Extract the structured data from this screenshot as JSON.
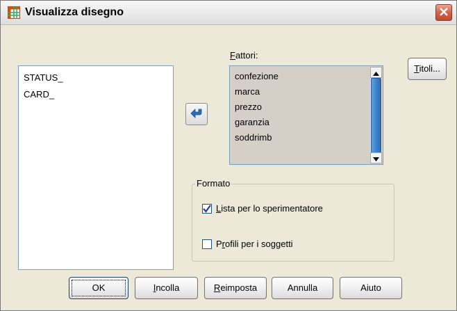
{
  "window": {
    "title": "Visualizza disegno",
    "icons": {
      "app": "grid-table-icon",
      "close": "close-icon"
    }
  },
  "source_list": {
    "items": [
      "STATUS_",
      "CARD_"
    ]
  },
  "move_button": {
    "icon": "arrow-left-icon"
  },
  "factors": {
    "label_mnemonic": "F",
    "label_rest": "attori:",
    "items": [
      "confezione",
      "marca",
      "prezzo",
      "garanzia",
      "soddrimb"
    ]
  },
  "titoli_button": {
    "mnemonic": "T",
    "rest": "itoli..."
  },
  "format_group": {
    "legend": "Formato",
    "options": [
      {
        "mnemonic": "L",
        "rest": "ista per lo sperimentatore",
        "checked": true
      },
      {
        "prefix": "P",
        "mnemonic": "r",
        "rest": "ofili per i soggetti",
        "checked": false
      }
    ]
  },
  "buttons": {
    "ok": "OK",
    "incolla": {
      "mnemonic": "I",
      "rest": "ncolla"
    },
    "reimposta": {
      "mnemonic": "R",
      "rest": "eimposta"
    },
    "annulla": "Annulla",
    "aiuto": "Aiuto"
  },
  "colors": {
    "dialog_bg": "#ece9d8",
    "list_selected_bg": "#d4d0c8",
    "scroll_thumb": "#3b7fc6",
    "close_button": "#c14a32"
  }
}
